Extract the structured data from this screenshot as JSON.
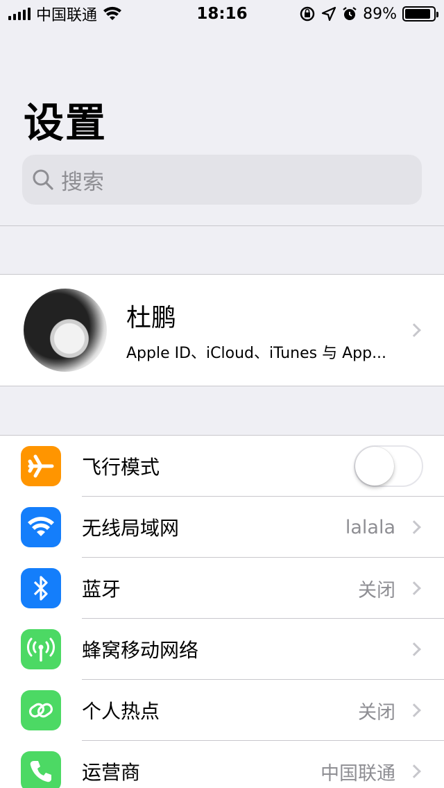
{
  "status_bar": {
    "carrier": "中国联通",
    "time": "18:16",
    "battery_percent": "89%",
    "battery_level": 0.89
  },
  "header": {
    "title": "设置",
    "search_placeholder": "搜索"
  },
  "profile": {
    "name": "杜鹏",
    "subtitle": "Apple ID、iCloud、iTunes 与 App..."
  },
  "settings": [
    {
      "label": "飞行模式",
      "value": "",
      "icon": "airplane-icon",
      "color": "#ff9500",
      "toggle": false
    },
    {
      "label": "无线局域网",
      "value": "lalala",
      "icon": "wifi-icon",
      "color": "#147efb"
    },
    {
      "label": "蓝牙",
      "value": "关闭",
      "icon": "bluetooth-icon",
      "color": "#147efb"
    },
    {
      "label": "蜂窝移动网络",
      "value": "",
      "icon": "cellular-icon",
      "color": "#4cd964"
    },
    {
      "label": "个人热点",
      "value": "关闭",
      "icon": "hotspot-icon",
      "color": "#4cd964"
    },
    {
      "label": "运营商",
      "value": "中国联通",
      "icon": "phone-icon",
      "color": "#4cd964"
    }
  ],
  "colors": {
    "background": "#efeff4",
    "separator": "#c8c7cc",
    "secondary_text": "#8e8e93"
  }
}
